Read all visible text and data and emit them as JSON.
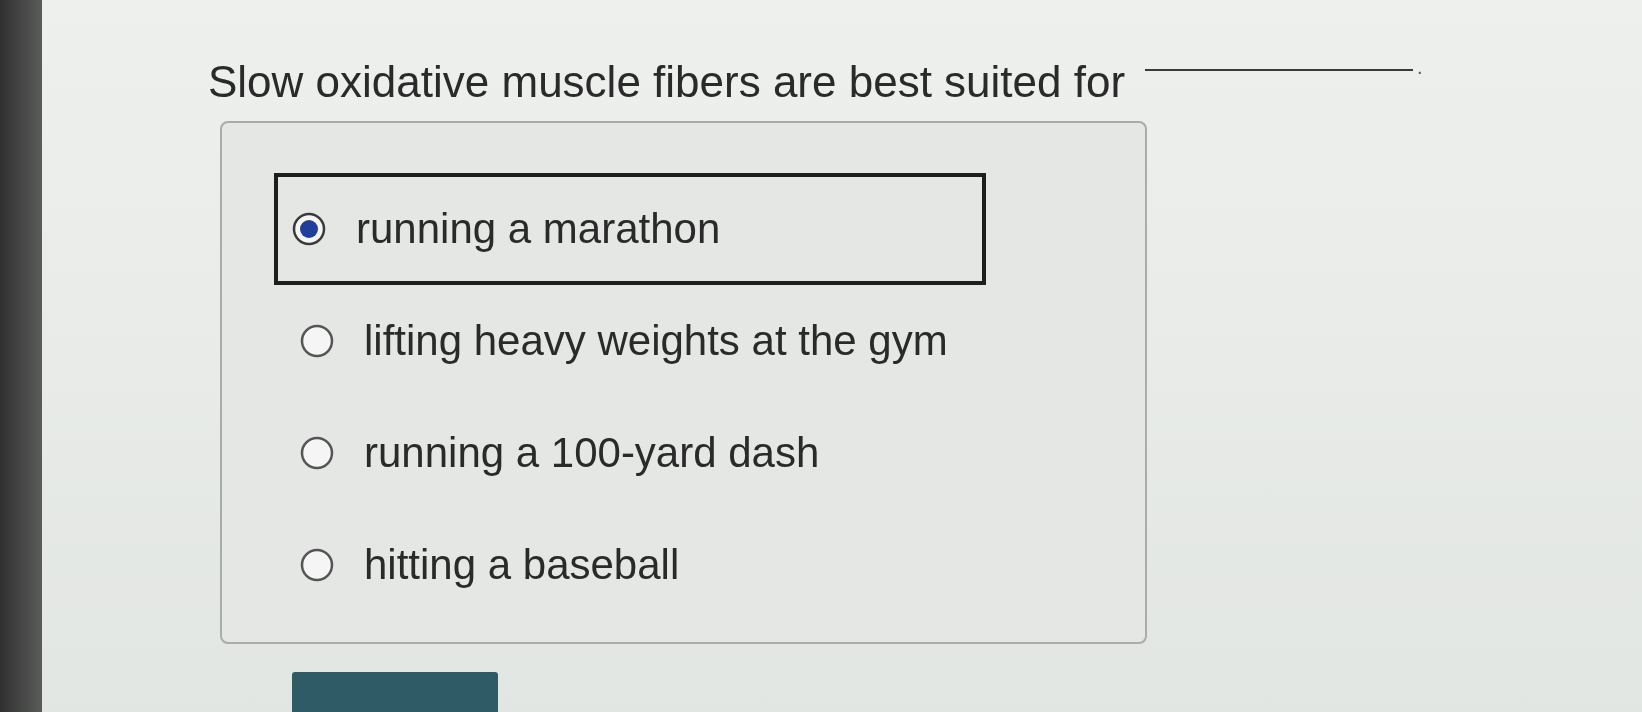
{
  "question": {
    "text": "Slow oxidative muscle fibers are best suited for",
    "suffix": "."
  },
  "options": [
    {
      "label": "running a marathon",
      "selected": true
    },
    {
      "label": "lifting heavy weights at the gym",
      "selected": false
    },
    {
      "label": "running a 100-yard dash",
      "selected": false
    },
    {
      "label": "hitting a baseball",
      "selected": false
    }
  ]
}
